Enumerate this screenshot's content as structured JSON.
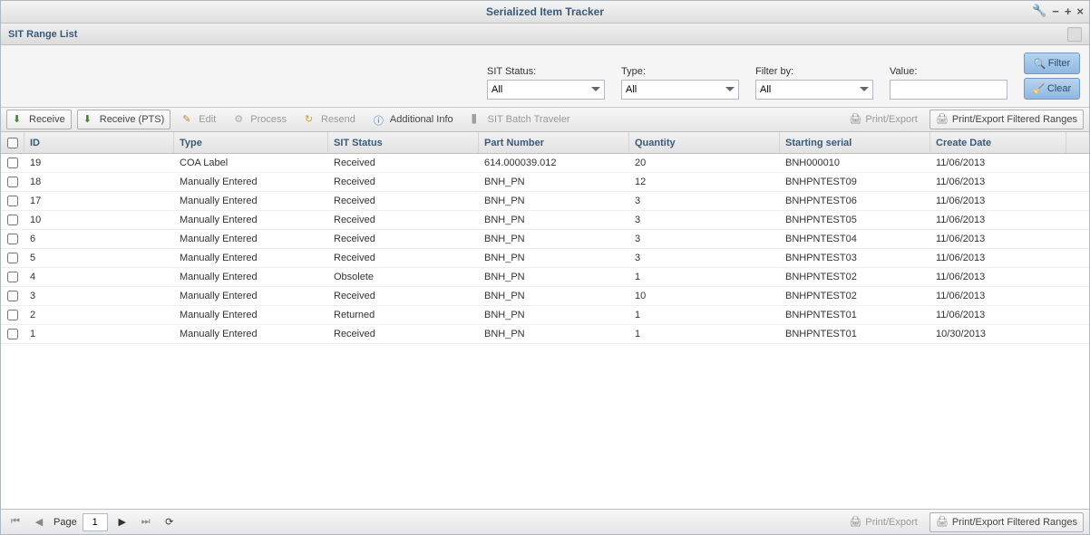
{
  "window": {
    "title": "Serialized Item Tracker"
  },
  "subheader": {
    "title": "SIT Range List"
  },
  "filters": {
    "sit_status": {
      "label": "SIT Status:",
      "value": "All"
    },
    "type": {
      "label": "Type:",
      "value": "All"
    },
    "filter_by": {
      "label": "Filter by:",
      "value": "All"
    },
    "value": {
      "label": "Value:",
      "value": ""
    },
    "filter_btn": "Filter",
    "clear_btn": "Clear"
  },
  "toolbar": {
    "receive": "Receive",
    "receive_pts": "Receive (PTS)",
    "edit": "Edit",
    "process": "Process",
    "resend": "Resend",
    "additional_info": "Additional Info",
    "batch_traveler": "SIT Batch Traveler",
    "print_export": "Print/Export",
    "print_export_filtered": "Print/Export Filtered Ranges"
  },
  "columns": {
    "id": "ID",
    "type": "Type",
    "status": "SIT Status",
    "part": "Part Number",
    "qty": "Quantity",
    "serial": "Starting serial",
    "date": "Create Date"
  },
  "rows": [
    {
      "id": "19",
      "type": "COA Label",
      "status": "Received",
      "part": "614.000039.012",
      "qty": "20",
      "serial": "BNH000010",
      "date": "11/06/2013"
    },
    {
      "id": "18",
      "type": "Manually Entered",
      "status": "Received",
      "part": "BNH_PN",
      "qty": "12",
      "serial": "BNHPNTEST09",
      "date": "11/06/2013"
    },
    {
      "id": "17",
      "type": "Manually Entered",
      "status": "Received",
      "part": "BNH_PN",
      "qty": "3",
      "serial": "BNHPNTEST06",
      "date": "11/06/2013"
    },
    {
      "id": "10",
      "type": "Manually Entered",
      "status": "Received",
      "part": "BNH_PN",
      "qty": "3",
      "serial": "BNHPNTEST05",
      "date": "11/06/2013"
    },
    {
      "id": "6",
      "type": "Manually Entered",
      "status": "Received",
      "part": "BNH_PN",
      "qty": "3",
      "serial": "BNHPNTEST04",
      "date": "11/06/2013"
    },
    {
      "id": "5",
      "type": "Manually Entered",
      "status": "Received",
      "part": "BNH_PN",
      "qty": "3",
      "serial": "BNHPNTEST03",
      "date": "11/06/2013"
    },
    {
      "id": "4",
      "type": "Manually Entered",
      "status": "Obsolete",
      "part": "BNH_PN",
      "qty": "1",
      "serial": "BNHPNTEST02",
      "date": "11/06/2013"
    },
    {
      "id": "3",
      "type": "Manually Entered",
      "status": "Received",
      "part": "BNH_PN",
      "qty": "10",
      "serial": "BNHPNTEST02",
      "date": "11/06/2013"
    },
    {
      "id": "2",
      "type": "Manually Entered",
      "status": "Returned",
      "part": "BNH_PN",
      "qty": "1",
      "serial": "BNHPNTEST01",
      "date": "11/06/2013"
    },
    {
      "id": "1",
      "type": "Manually Entered",
      "status": "Received",
      "part": "BNH_PN",
      "qty": "1",
      "serial": "BNHPNTEST01",
      "date": "10/30/2013"
    }
  ],
  "pager": {
    "page_label": "Page",
    "page": "1"
  },
  "footer": {
    "print_export": "Print/Export",
    "print_export_filtered": "Print/Export Filtered Ranges"
  }
}
